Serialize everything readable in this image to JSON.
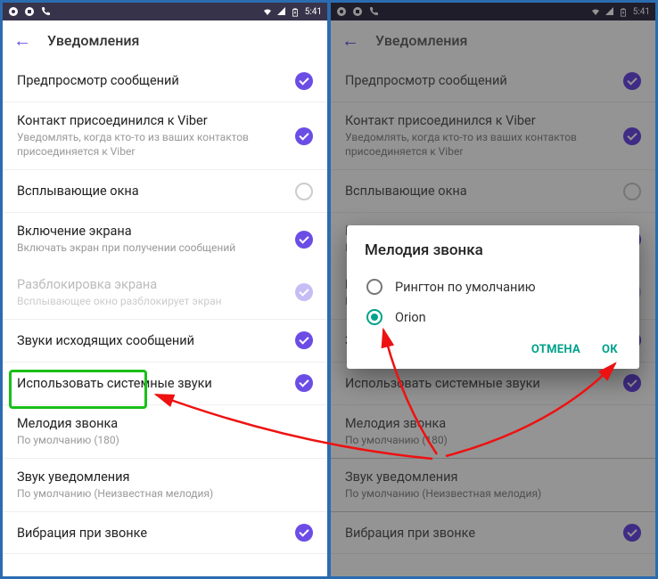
{
  "statusbar": {
    "time": "5:41"
  },
  "appbar": {
    "title": "Уведомления"
  },
  "rows": {
    "preview": {
      "title": "Предпросмотр сообщений"
    },
    "joined": {
      "title": "Контакт присоединился к Viber",
      "sub": "Уведомлять, когда кто-то из ваших контактов присоединяется к Viber"
    },
    "popup": {
      "title": "Всплывающие окна"
    },
    "screenon": {
      "title": "Включение экрана",
      "sub": "Включать экран при получении сообщений"
    },
    "unlock": {
      "title": "Разблокировка экрана",
      "sub": "Всплывающее окно разблокирует экран"
    },
    "outgoing": {
      "title": "Звуки исходящих сообщений"
    },
    "system": {
      "title": "Использовать системные звуки"
    },
    "ringtone": {
      "title": "Мелодия звонка",
      "sub": "По умолчанию (180)"
    },
    "notifsound": {
      "title": "Звук уведомления",
      "sub": "По умолчанию (Неизвестная мелодия)"
    },
    "vibrate": {
      "title": "Вибрация при звонке"
    }
  },
  "dialog": {
    "title": "Мелодия звонка",
    "opt_default": "Рингтон по умолчанию",
    "opt_orion": "Orion",
    "cancel": "ОТМЕНА",
    "ok": "ОК"
  }
}
